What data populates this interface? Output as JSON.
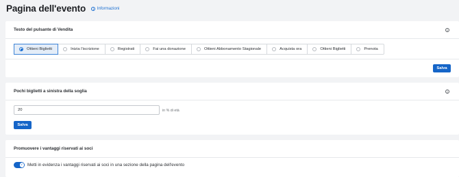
{
  "page": {
    "title": "Pagina dell'evento",
    "info_link": "Informazioni"
  },
  "sell_button_card": {
    "title": "Testo del pulsante di Vendita",
    "options": [
      {
        "label": "Ottieni Biglietti",
        "selected": true
      },
      {
        "label": "Inizia l'iscrizione",
        "selected": false
      },
      {
        "label": "Registrati",
        "selected": false
      },
      {
        "label": "Fai una donazione",
        "selected": false
      },
      {
        "label": "Ottieni Abbonamento Stagionale",
        "selected": false
      },
      {
        "label": "Acquista ora",
        "selected": false
      },
      {
        "label": "Ottieni Biglietti",
        "selected": false
      },
      {
        "label": "Prenota",
        "selected": false
      }
    ],
    "save_label": "Salva"
  },
  "threshold_card": {
    "title": "Pochi biglietti a sinistra della soglia",
    "input_value": "20",
    "suffix": "in % di età",
    "save_label": "Salva"
  },
  "members_card": {
    "title": "Promuovere i vantaggi riservati ai soci",
    "toggle_on": true,
    "toggle_label": "Metti in evidenza i vantaggi riservati ai soci in una sezione della pagina dell'evento"
  },
  "colors": {
    "accent": "#1565c8",
    "link": "#1b6fd1",
    "background": "#f2f3f5"
  }
}
